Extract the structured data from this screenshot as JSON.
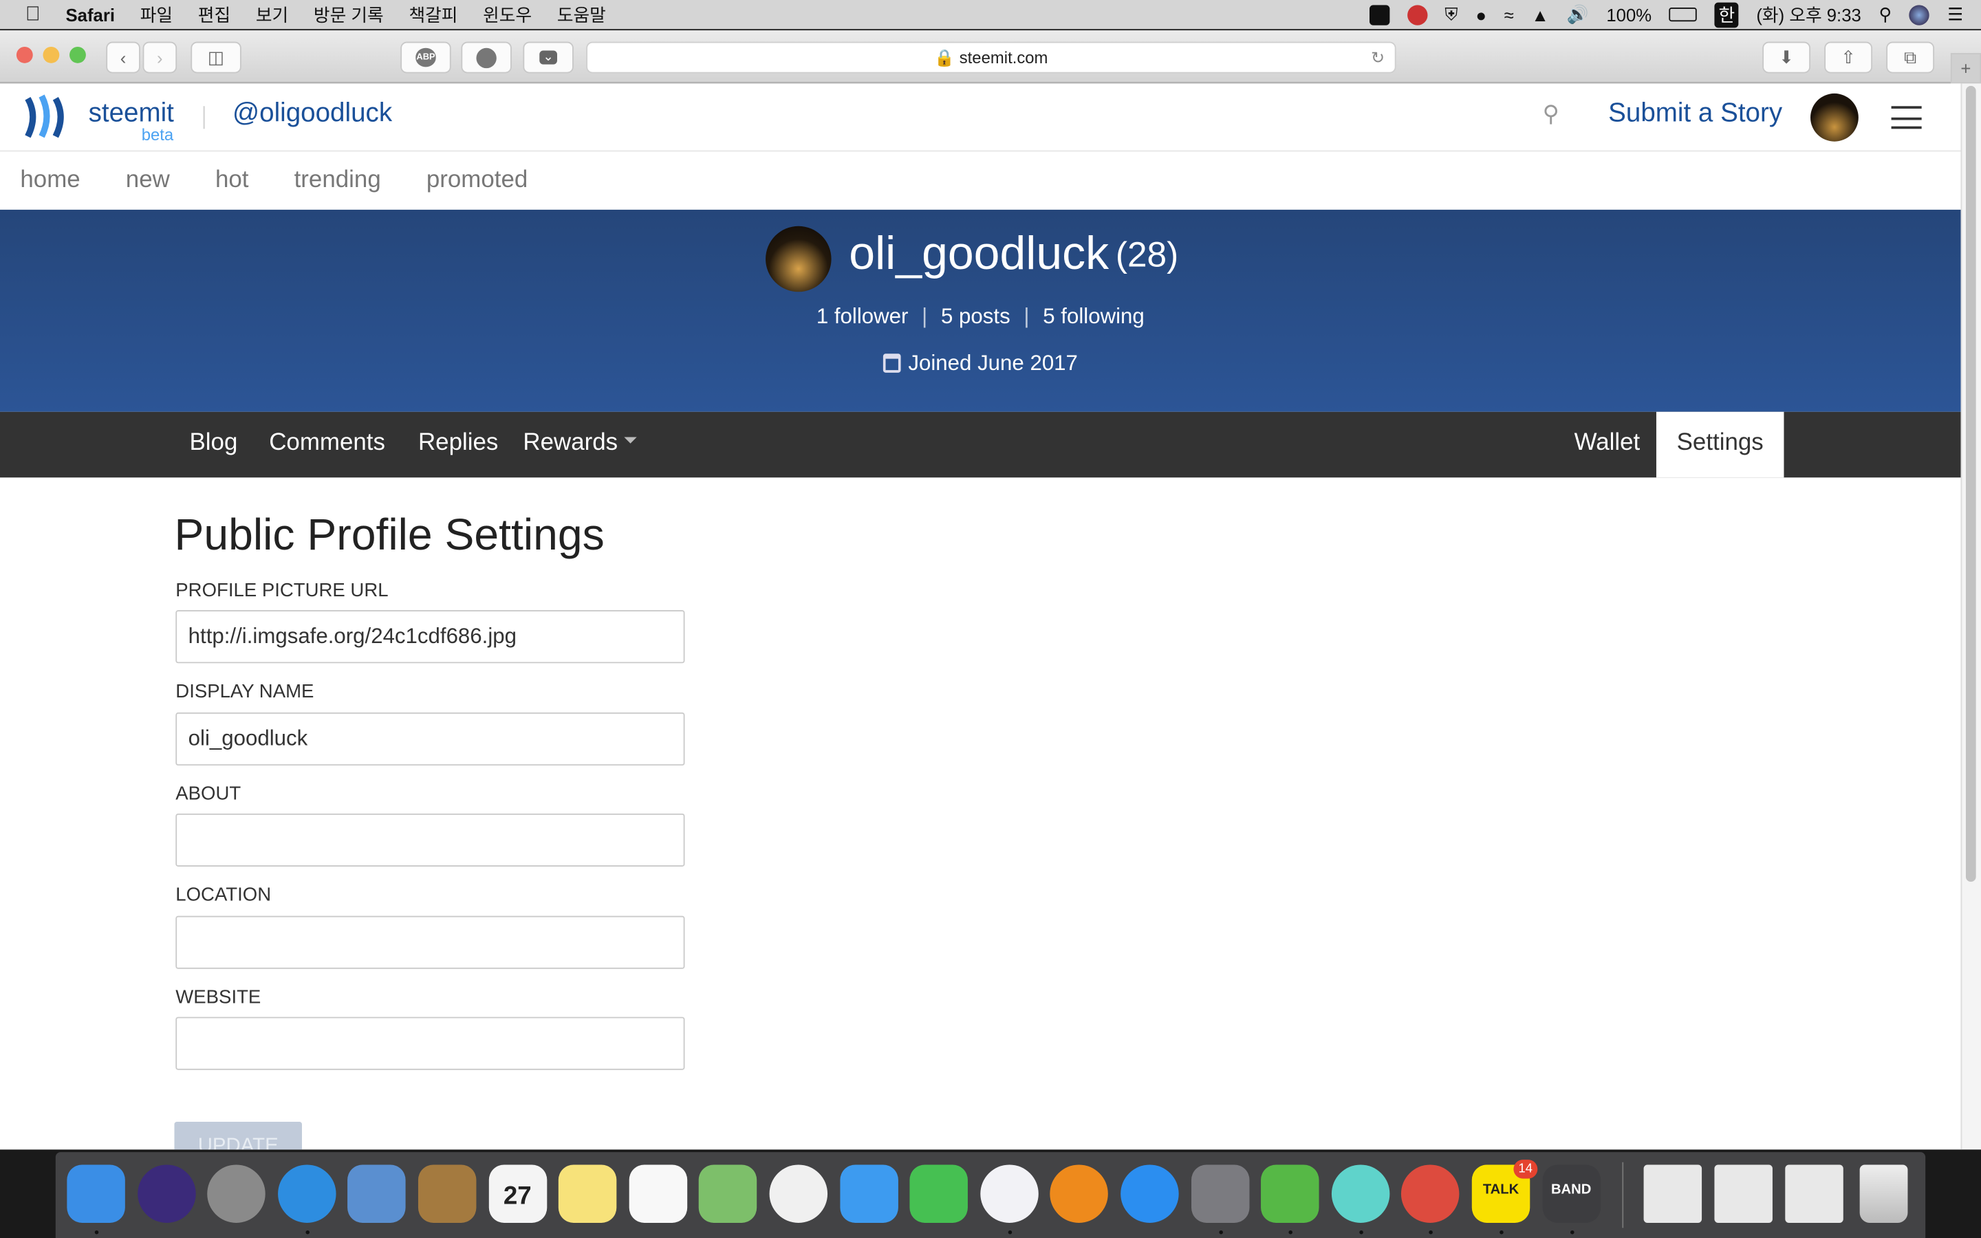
{
  "menubar": {
    "app": "Safari",
    "items": [
      "파일",
      "편집",
      "보기",
      "방문 기록",
      "책갈피",
      "윈도우",
      "도움말"
    ],
    "battery": "100%",
    "input_method": "한",
    "clock": "(화) 오후 9:33"
  },
  "browser": {
    "url": "steemit.com",
    "buttons": [
      "back",
      "forward",
      "sidebar",
      "adblock",
      "duckduckgo",
      "pocket",
      "downloads",
      "share",
      "tabs"
    ],
    "adblock_label": "ABP"
  },
  "header": {
    "logo": "steemit",
    "logo_sub": "beta",
    "account": "@oligoodluck",
    "submit": "Submit a Story"
  },
  "nav": [
    "home",
    "new",
    "hot",
    "trending",
    "promoted"
  ],
  "profile": {
    "name": "oli_goodluck",
    "reputation": "(28)",
    "followers": "1 follower",
    "posts": "5 posts",
    "following": "5 following",
    "joined": "Joined June 2017"
  },
  "tabs": {
    "left": [
      "Blog",
      "Comments",
      "Replies",
      "Rewards"
    ],
    "right": [
      "Wallet",
      "Settings"
    ],
    "active": "Settings"
  },
  "settings": {
    "title": "Public Profile Settings",
    "fields": [
      {
        "label": "PROFILE PICTURE URL",
        "value": "http://i.imgsafe.org/24c1cdf686.jpg"
      },
      {
        "label": "DISPLAY NAME",
        "value": "oli_goodluck"
      },
      {
        "label": "ABOUT",
        "value": ""
      },
      {
        "label": "LOCATION",
        "value": ""
      },
      {
        "label": "WEBSITE",
        "value": ""
      }
    ],
    "update": "UPDATE"
  },
  "dock": {
    "apps": [
      {
        "name": "finder",
        "color": "#3a8ee6",
        "running": true
      },
      {
        "name": "siri",
        "color": "#3b2a7a",
        "running": false
      },
      {
        "name": "launchpad",
        "color": "#8a8a8a",
        "running": false
      },
      {
        "name": "safari",
        "color": "#2d8de0",
        "running": true
      },
      {
        "name": "mail",
        "color": "#5a8fd0",
        "running": false
      },
      {
        "name": "contacts",
        "color": "#a47a3f",
        "running": false
      },
      {
        "name": "calendar",
        "color": "#f4f4f4",
        "running": false,
        "label": "27"
      },
      {
        "name": "notes",
        "color": "#f7e27a",
        "running": false
      },
      {
        "name": "reminders",
        "color": "#f8f8f8",
        "running": false
      },
      {
        "name": "maps",
        "color": "#7dbf6a",
        "running": false
      },
      {
        "name": "photos",
        "color": "#f0f0f0",
        "running": false
      },
      {
        "name": "messages",
        "color": "#3d9bf0",
        "running": false
      },
      {
        "name": "facetime",
        "color": "#46c052",
        "running": false
      },
      {
        "name": "itunes",
        "color": "#f2f2f6",
        "running": true
      },
      {
        "name": "ibooks",
        "color": "#ee8a1c",
        "running": false
      },
      {
        "name": "app-store",
        "color": "#2b8ef0",
        "running": false
      },
      {
        "name": "system-preferences",
        "color": "#7b7b80",
        "running": true
      },
      {
        "name": "evernote",
        "color": "#56b846",
        "running": true
      },
      {
        "name": "teal-app",
        "color": "#5fd3cb",
        "running": true
      },
      {
        "name": "chrome",
        "color": "#dd4b3e",
        "running": true
      },
      {
        "name": "kakaotalk",
        "color": "#f9e000",
        "running": true,
        "badge": "14",
        "label": "TALK"
      },
      {
        "name": "band",
        "color": "#3d3d40",
        "running": true,
        "label": "BAND"
      }
    ],
    "stacks": [
      "downloads-stack",
      "documents-stack",
      "screenshots-stack"
    ],
    "trash": "trash"
  }
}
